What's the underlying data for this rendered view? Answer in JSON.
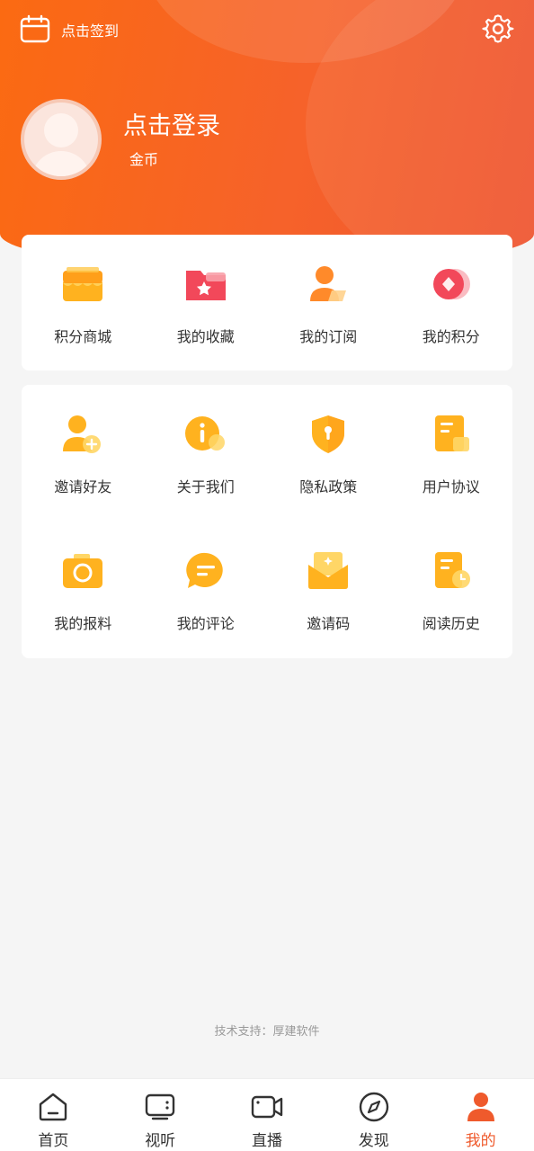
{
  "header": {
    "checkin_label": "点击签到",
    "login_label": "点击登录",
    "coins_label": "金币"
  },
  "menu_primary": [
    {
      "label": "积分商城",
      "icon": "store-icon"
    },
    {
      "label": "我的收藏",
      "icon": "favorite-folder-icon"
    },
    {
      "label": "我的订阅",
      "icon": "subscription-user-icon"
    },
    {
      "label": "我的积分",
      "icon": "points-coin-icon"
    }
  ],
  "menu_secondary": [
    {
      "label": "邀请好友",
      "icon": "invite-friend-icon"
    },
    {
      "label": "关于我们",
      "icon": "info-icon"
    },
    {
      "label": "隐私政策",
      "icon": "privacy-shield-icon"
    },
    {
      "label": "用户协议",
      "icon": "agreement-document-icon"
    },
    {
      "label": "我的报料",
      "icon": "camera-icon"
    },
    {
      "label": "我的评论",
      "icon": "comment-bubble-icon"
    },
    {
      "label": "邀请码",
      "icon": "invite-code-envelope-icon"
    },
    {
      "label": "阅读历史",
      "icon": "reading-history-icon"
    }
  ],
  "footer_text": "技术支持：厚建软件",
  "tabbar": [
    {
      "label": "首页",
      "icon": "home-icon",
      "active": false
    },
    {
      "label": "视听",
      "icon": "tv-icon",
      "active": false
    },
    {
      "label": "直播",
      "icon": "video-camera-icon",
      "active": false
    },
    {
      "label": "发现",
      "icon": "compass-icon",
      "active": false
    },
    {
      "label": "我的",
      "icon": "profile-icon",
      "active": true
    }
  ],
  "colors": {
    "brand": "#f6622a",
    "icon_yellow": "#ffb21f",
    "icon_red": "#f2485a",
    "tab_active": "#ef5a2c",
    "background": "#f5f5f5"
  }
}
